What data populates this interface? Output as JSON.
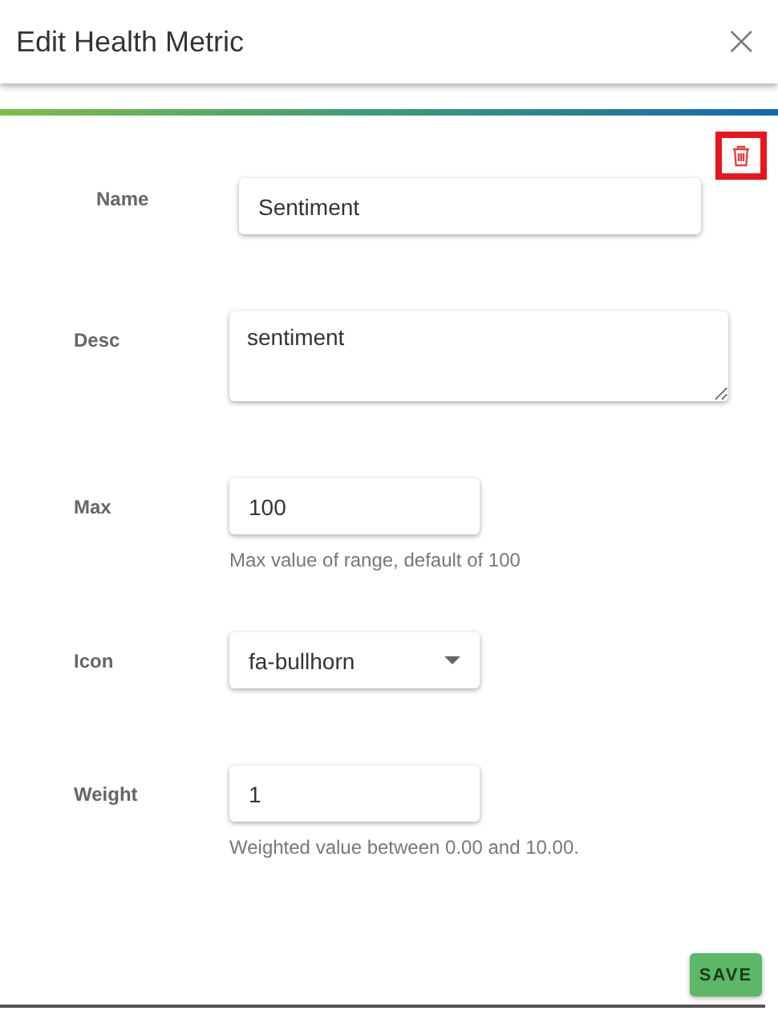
{
  "dialog": {
    "title": "Edit Health Metric",
    "close_icon": "×"
  },
  "delete_button": {
    "highlighted": true
  },
  "fields": [
    {
      "kind": "text",
      "label": "Name",
      "value": "Sentiment"
    },
    {
      "kind": "textarea",
      "label": "Desc",
      "value": "sentiment"
    },
    {
      "kind": "text",
      "label": "Max",
      "value": "100",
      "help": "Max value of range, default of 100"
    },
    {
      "kind": "select",
      "label": "Icon",
      "value": "fa-bullhorn"
    },
    {
      "kind": "text",
      "label": "Weight",
      "value": "1",
      "help": "Weighted value between 0.00 and 10.00."
    }
  ],
  "save_button": {
    "label": "SAVE"
  }
}
